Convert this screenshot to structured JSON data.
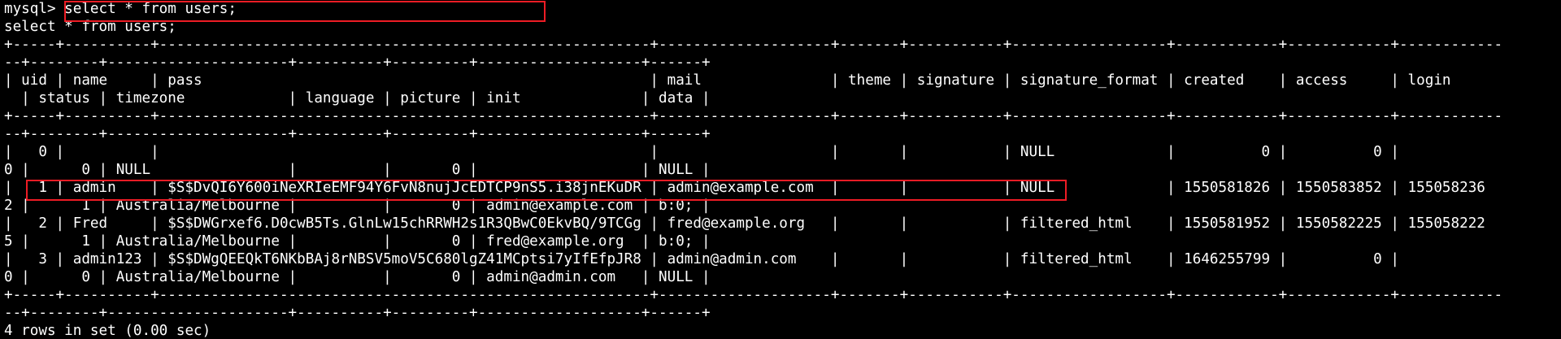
{
  "terminal": {
    "lines": [
      "mysql> select * from users;",
      "select * from users;",
      "+-----+----------+---------------------------------------------------------+--------------------+-------+-----------+------------------+------------+------------+------------",
      "--+--------+---------------------+----------+---------+-------------------+------+",
      "| uid | name     | pass                                                    | mail               | theme | signature | signature_format | created    | access     | login",
      "  | status | timezone            | language | picture | init              | data |",
      "+-----+----------+---------------------------------------------------------+--------------------+-------+-----------+------------------+------------+------------+------------",
      "--+--------+---------------------+----------+---------+-------------------+------+",
      "|   0 |          |                                                         |                    |       |           | NULL             |          0 |          0 |",
      "0 |      0 | NULL                |          |       0 |                   | NULL |",
      "|   1 | admin    | $S$DvQI6Y600iNeXRIeEMF94Y6FvN8nujJcEDTCP9nS5.i38jnEKuDR | admin@example.com  |       |           | NULL             | 1550581826 | 1550583852 | 155058236",
      "2 |      1 | Australia/Melbourne |          |       0 | admin@example.com | b:0; |",
      "|   2 | Fred     | $S$DWGrxef6.D0cwB5Ts.GlnLw15chRRWH2s1R3QBwC0EkvBQ/9TCGg | fred@example.org   |       |           | filtered_html    | 1550581952 | 1550582225 | 155058222",
      "5 |      1 | Australia/Melbourne |          |       0 | fred@example.org  | b:0; |",
      "|   3 | admin123 | $S$DWgQEEQkT6NKbBAj8rNBSV5moV5C680lgZ41MCptsi7yIfEfpJR8 | admin@admin.com    |       |           | filtered_html    | 1646255799 |          0 |",
      "0 |      0 | Australia/Melbourne |          |       0 | admin@admin.com   | NULL |",
      "+-----+----------+---------------------------------------------------------+--------------------+-------+-----------+------------------+------------+------------+------------",
      "--+--------+---------------------+----------+---------+-------------------+------+",
      "4 rows in set (0.00 sec)"
    ]
  },
  "colors": {
    "background": "#000000",
    "text": "#ffffff",
    "highlight": "#ee1c25"
  }
}
